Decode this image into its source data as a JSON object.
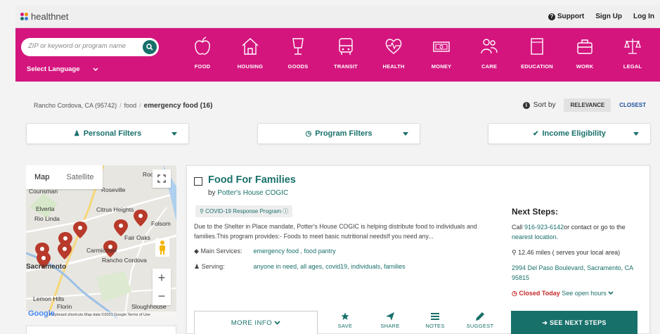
{
  "header": {
    "logo": "healthnet",
    "links": {
      "support": "Support",
      "signup": "Sign Up",
      "login": "Log In"
    }
  },
  "nav": {
    "search_placeholder": "ZIP or keyword or program name",
    "language": "Select Language",
    "categories": [
      {
        "label": "FOOD",
        "icon": "apple-icon"
      },
      {
        "label": "HOUSING",
        "icon": "house-icon"
      },
      {
        "label": "GOODS",
        "icon": "lamp-icon"
      },
      {
        "label": "TRANSIT",
        "icon": "bus-icon"
      },
      {
        "label": "HEALTH",
        "icon": "heart-pulse-icon"
      },
      {
        "label": "MONEY",
        "icon": "money-icon"
      },
      {
        "label": "CARE",
        "icon": "people-icon"
      },
      {
        "label": "EDUCATION",
        "icon": "book-icon"
      },
      {
        "label": "WORK",
        "icon": "briefcase-icon"
      },
      {
        "label": "LEGAL",
        "icon": "scales-icon"
      }
    ],
    "bg_color": "#d4157e"
  },
  "breadcrumb": {
    "location": "Rancho Cordova, CA (95742)",
    "category": "food",
    "current": "emergency food (16)"
  },
  "sort": {
    "label": "Sort by",
    "relevance": "RELEVANCE",
    "closest": "CLOSEST"
  },
  "filters": {
    "personal": "Personal Filters",
    "program": "Program Filters",
    "income": "Income Eligibility"
  },
  "map": {
    "tab_map": "Map",
    "tab_satellite": "Satellite",
    "labels": [
      "Rocklin",
      "Counsman",
      "Roseville",
      "Elverta",
      "Citrus Heights",
      "Rio Linda",
      "Folsom",
      "Fair Oaks",
      "Carmichael",
      "Rancho Cordova",
      "Sacramento",
      "Lemon Hills",
      "Florin",
      "Sloughhouse"
    ],
    "footer": "Keyboard shortcuts   Map data ©2021 Google   Terms of Use",
    "google": "Google",
    "zoom_in": "+",
    "zoom_out": "−"
  },
  "result": {
    "title": "Food For Families",
    "by": "by",
    "provider": "Potter's House COGIC",
    "badge": "COVID-19 Response Program",
    "description": "Due to the Shelter in Place mandate, Potter's House COGIC is helping distribute food to individuals and families.This program provides:- Foods to meet basic nutritional needsIf you need any...",
    "main_services_label": "Main Services:",
    "main_services": "emergency food , food pantry",
    "serving_label": "Serving:",
    "serving": "anyone in need, all ages, covid19, individuals, families",
    "next_steps": {
      "heading": "Next Steps:",
      "call": "Call",
      "phone": "916-923-6142",
      "call_rest": "or contact or go to the",
      "nearest": "nearest location",
      "distance": "12.46 miles ( serves your local area)",
      "address": "2994 Del Paso Boulevard, Sacramento, CA 95815",
      "closed": "Closed Today",
      "hours": "See open hours"
    },
    "actions": {
      "more": "MORE INFO",
      "save": "SAVE",
      "share": "SHARE",
      "notes": "NOTES",
      "suggest": "SUGGEST",
      "see_next": "SEE NEXT STEPS"
    }
  }
}
